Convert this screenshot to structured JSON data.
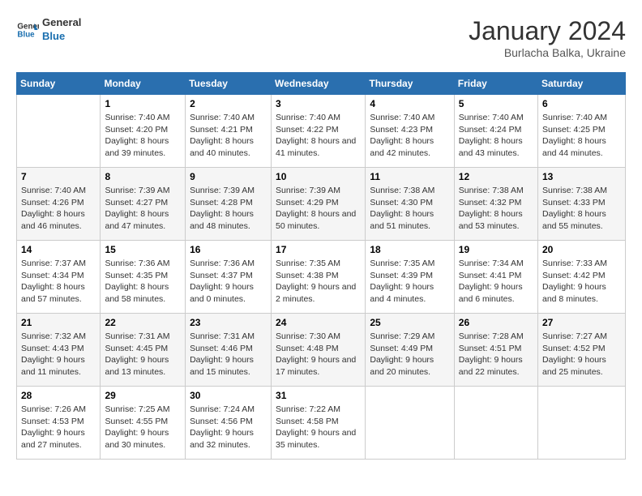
{
  "header": {
    "logo_line1": "General",
    "logo_line2": "Blue",
    "month_year": "January 2024",
    "location": "Burlacha Balka, Ukraine"
  },
  "days_of_week": [
    "Sunday",
    "Monday",
    "Tuesday",
    "Wednesday",
    "Thursday",
    "Friday",
    "Saturday"
  ],
  "weeks": [
    [
      {
        "num": "",
        "sunrise": "",
        "sunset": "",
        "daylight": ""
      },
      {
        "num": "1",
        "sunrise": "Sunrise: 7:40 AM",
        "sunset": "Sunset: 4:20 PM",
        "daylight": "Daylight: 8 hours and 39 minutes."
      },
      {
        "num": "2",
        "sunrise": "Sunrise: 7:40 AM",
        "sunset": "Sunset: 4:21 PM",
        "daylight": "Daylight: 8 hours and 40 minutes."
      },
      {
        "num": "3",
        "sunrise": "Sunrise: 7:40 AM",
        "sunset": "Sunset: 4:22 PM",
        "daylight": "Daylight: 8 hours and 41 minutes."
      },
      {
        "num": "4",
        "sunrise": "Sunrise: 7:40 AM",
        "sunset": "Sunset: 4:23 PM",
        "daylight": "Daylight: 8 hours and 42 minutes."
      },
      {
        "num": "5",
        "sunrise": "Sunrise: 7:40 AM",
        "sunset": "Sunset: 4:24 PM",
        "daylight": "Daylight: 8 hours and 43 minutes."
      },
      {
        "num": "6",
        "sunrise": "Sunrise: 7:40 AM",
        "sunset": "Sunset: 4:25 PM",
        "daylight": "Daylight: 8 hours and 44 minutes."
      }
    ],
    [
      {
        "num": "7",
        "sunrise": "Sunrise: 7:40 AM",
        "sunset": "Sunset: 4:26 PM",
        "daylight": "Daylight: 8 hours and 46 minutes."
      },
      {
        "num": "8",
        "sunrise": "Sunrise: 7:39 AM",
        "sunset": "Sunset: 4:27 PM",
        "daylight": "Daylight: 8 hours and 47 minutes."
      },
      {
        "num": "9",
        "sunrise": "Sunrise: 7:39 AM",
        "sunset": "Sunset: 4:28 PM",
        "daylight": "Daylight: 8 hours and 48 minutes."
      },
      {
        "num": "10",
        "sunrise": "Sunrise: 7:39 AM",
        "sunset": "Sunset: 4:29 PM",
        "daylight": "Daylight: 8 hours and 50 minutes."
      },
      {
        "num": "11",
        "sunrise": "Sunrise: 7:38 AM",
        "sunset": "Sunset: 4:30 PM",
        "daylight": "Daylight: 8 hours and 51 minutes."
      },
      {
        "num": "12",
        "sunrise": "Sunrise: 7:38 AM",
        "sunset": "Sunset: 4:32 PM",
        "daylight": "Daylight: 8 hours and 53 minutes."
      },
      {
        "num": "13",
        "sunrise": "Sunrise: 7:38 AM",
        "sunset": "Sunset: 4:33 PM",
        "daylight": "Daylight: 8 hours and 55 minutes."
      }
    ],
    [
      {
        "num": "14",
        "sunrise": "Sunrise: 7:37 AM",
        "sunset": "Sunset: 4:34 PM",
        "daylight": "Daylight: 8 hours and 57 minutes."
      },
      {
        "num": "15",
        "sunrise": "Sunrise: 7:36 AM",
        "sunset": "Sunset: 4:35 PM",
        "daylight": "Daylight: 8 hours and 58 minutes."
      },
      {
        "num": "16",
        "sunrise": "Sunrise: 7:36 AM",
        "sunset": "Sunset: 4:37 PM",
        "daylight": "Daylight: 9 hours and 0 minutes."
      },
      {
        "num": "17",
        "sunrise": "Sunrise: 7:35 AM",
        "sunset": "Sunset: 4:38 PM",
        "daylight": "Daylight: 9 hours and 2 minutes."
      },
      {
        "num": "18",
        "sunrise": "Sunrise: 7:35 AM",
        "sunset": "Sunset: 4:39 PM",
        "daylight": "Daylight: 9 hours and 4 minutes."
      },
      {
        "num": "19",
        "sunrise": "Sunrise: 7:34 AM",
        "sunset": "Sunset: 4:41 PM",
        "daylight": "Daylight: 9 hours and 6 minutes."
      },
      {
        "num": "20",
        "sunrise": "Sunrise: 7:33 AM",
        "sunset": "Sunset: 4:42 PM",
        "daylight": "Daylight: 9 hours and 8 minutes."
      }
    ],
    [
      {
        "num": "21",
        "sunrise": "Sunrise: 7:32 AM",
        "sunset": "Sunset: 4:43 PM",
        "daylight": "Daylight: 9 hours and 11 minutes."
      },
      {
        "num": "22",
        "sunrise": "Sunrise: 7:31 AM",
        "sunset": "Sunset: 4:45 PM",
        "daylight": "Daylight: 9 hours and 13 minutes."
      },
      {
        "num": "23",
        "sunrise": "Sunrise: 7:31 AM",
        "sunset": "Sunset: 4:46 PM",
        "daylight": "Daylight: 9 hours and 15 minutes."
      },
      {
        "num": "24",
        "sunrise": "Sunrise: 7:30 AM",
        "sunset": "Sunset: 4:48 PM",
        "daylight": "Daylight: 9 hours and 17 minutes."
      },
      {
        "num": "25",
        "sunrise": "Sunrise: 7:29 AM",
        "sunset": "Sunset: 4:49 PM",
        "daylight": "Daylight: 9 hours and 20 minutes."
      },
      {
        "num": "26",
        "sunrise": "Sunrise: 7:28 AM",
        "sunset": "Sunset: 4:51 PM",
        "daylight": "Daylight: 9 hours and 22 minutes."
      },
      {
        "num": "27",
        "sunrise": "Sunrise: 7:27 AM",
        "sunset": "Sunset: 4:52 PM",
        "daylight": "Daylight: 9 hours and 25 minutes."
      }
    ],
    [
      {
        "num": "28",
        "sunrise": "Sunrise: 7:26 AM",
        "sunset": "Sunset: 4:53 PM",
        "daylight": "Daylight: 9 hours and 27 minutes."
      },
      {
        "num": "29",
        "sunrise": "Sunrise: 7:25 AM",
        "sunset": "Sunset: 4:55 PM",
        "daylight": "Daylight: 9 hours and 30 minutes."
      },
      {
        "num": "30",
        "sunrise": "Sunrise: 7:24 AM",
        "sunset": "Sunset: 4:56 PM",
        "daylight": "Daylight: 9 hours and 32 minutes."
      },
      {
        "num": "31",
        "sunrise": "Sunrise: 7:22 AM",
        "sunset": "Sunset: 4:58 PM",
        "daylight": "Daylight: 9 hours and 35 minutes."
      },
      {
        "num": "",
        "sunrise": "",
        "sunset": "",
        "daylight": ""
      },
      {
        "num": "",
        "sunrise": "",
        "sunset": "",
        "daylight": ""
      },
      {
        "num": "",
        "sunrise": "",
        "sunset": "",
        "daylight": ""
      }
    ]
  ]
}
